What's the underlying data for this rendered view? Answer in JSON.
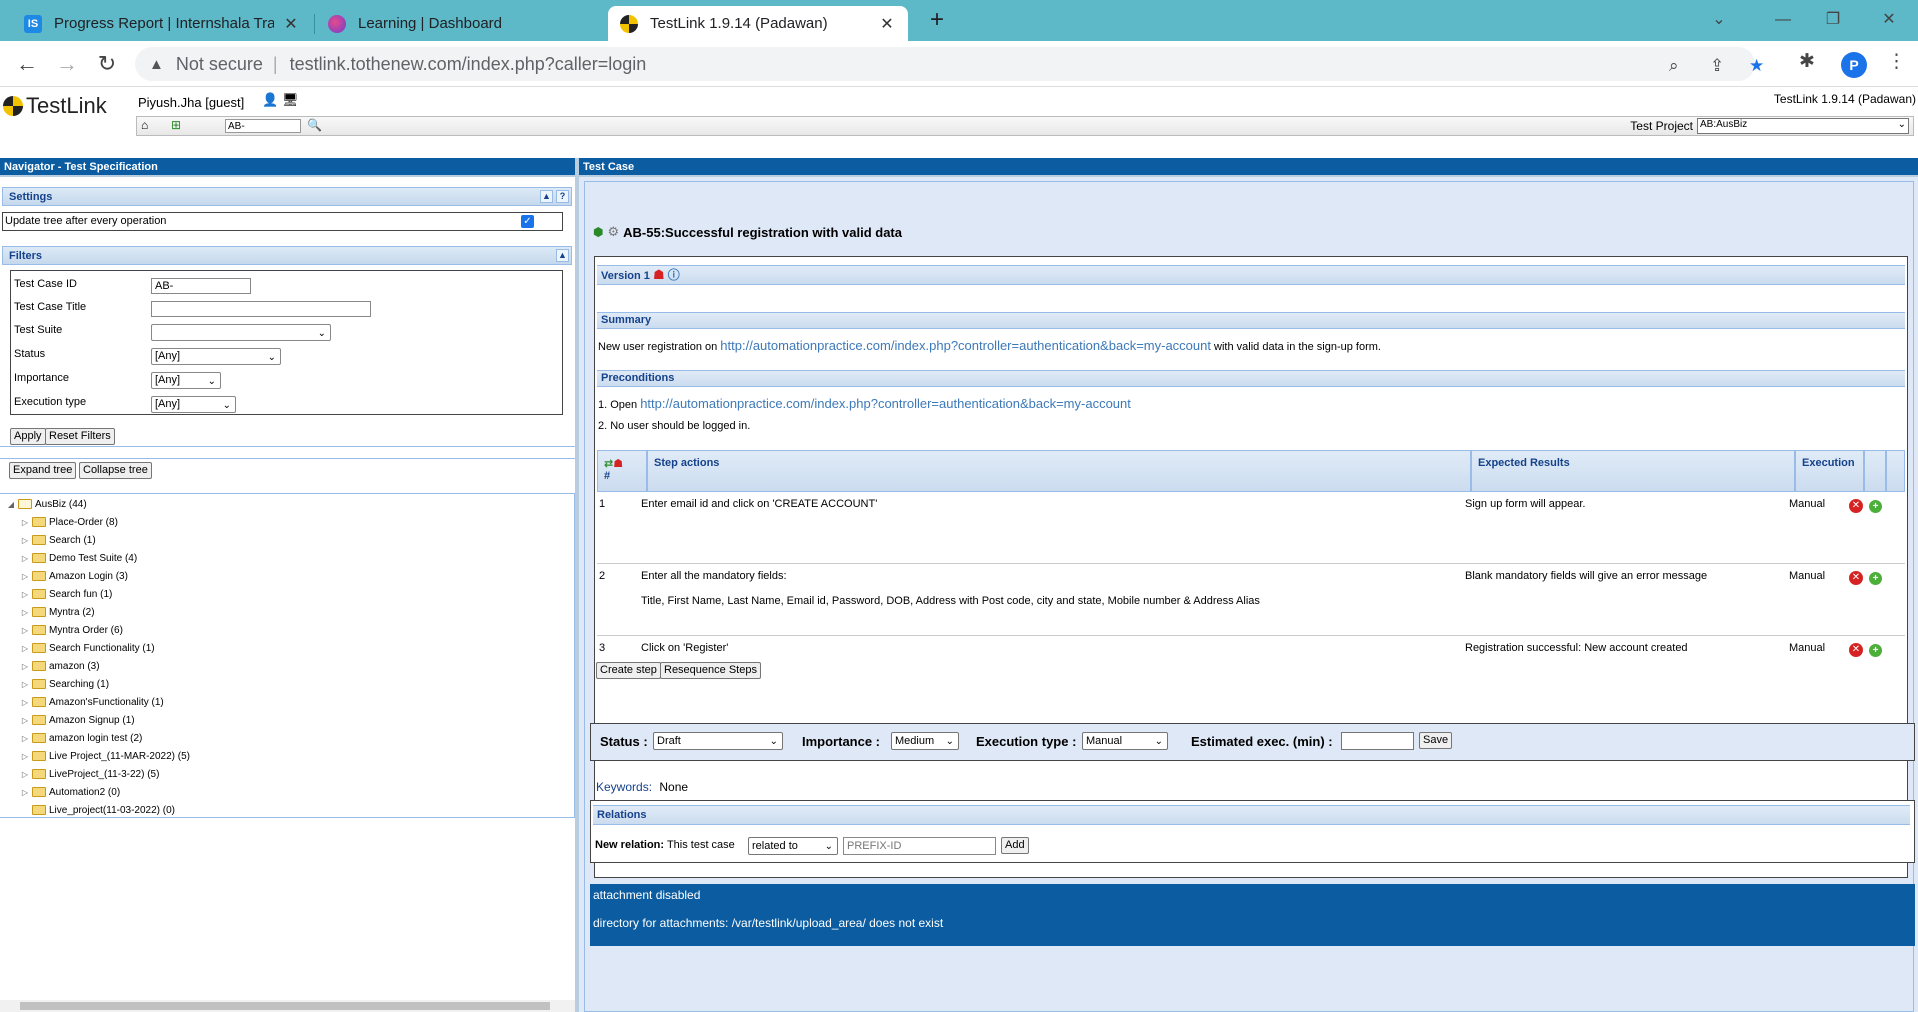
{
  "browser": {
    "tabs": [
      {
        "title": "Progress Report | Internshala Trai",
        "favicon": "IS"
      },
      {
        "title": "Learning | Dashboard",
        "favicon": ""
      },
      {
        "title": "TestLink 1.9.14 (Padawan)",
        "favicon": ""
      }
    ],
    "not_secure": "Not secure",
    "url": "testlink.tothenew.com/index.php?caller=login",
    "profile_initial": "P"
  },
  "header": {
    "logo_text": "TestLink",
    "user": "Piyush.Jha [guest]",
    "version": "TestLink 1.9.14 (Padawan)",
    "quick_tc_value": "AB-",
    "test_project_label": "Test Project",
    "test_project_value": "AB:AusBiz"
  },
  "navigator": {
    "title": "Navigator - Test Specification",
    "settings_title": "Settings",
    "update_tree_label": "Update tree after every operation",
    "filters_title": "Filters",
    "filters": [
      {
        "label": "Test Case ID",
        "value": "AB-"
      },
      {
        "label": "Test Case Title",
        "value": ""
      },
      {
        "label": "Test Suite",
        "value": ""
      },
      {
        "label": "Status",
        "value": "[Any]"
      },
      {
        "label": "Importance",
        "value": "[Any]"
      },
      {
        "label": "Execution type",
        "value": "[Any]"
      }
    ],
    "apply_label": "Apply",
    "reset_label": "Reset Filters",
    "expand_label": "Expand tree",
    "collapse_label": "Collapse tree",
    "tree_root": "AusBiz (44)",
    "tree": [
      "Place-Order (8)",
      "Search (1)",
      "Demo Test Suite (4)",
      "Amazon Login (3)",
      "Search fun (1)",
      "Myntra (2)",
      "Myntra Order (6)",
      "Search Functionality (1)",
      "amazon (3)",
      "Searching (1)",
      "Amazon'sFunctionality (1)",
      "Amazon Signup (1)",
      "amazon login test (2)",
      "Live Project_(11-MAR-2022) (5)",
      "LiveProject_(11-3-22) (5)",
      "Automation2 (0)",
      "Live_project(11-03-2022) (0)"
    ]
  },
  "testcase": {
    "pane_title": "Test Case",
    "title": "AB-55:Successful registration with valid data",
    "version": "Version 1",
    "summary_title": "Summary",
    "summary_pre": "New user registration on",
    "summary_link": "http://automationpractice.com/index.php?controller=authentication&back=my-account",
    "summary_post": "with valid data in the sign-up form.",
    "preconditions_title": "Preconditions",
    "pre1_prefix": "1. Open",
    "pre1_link": "http://automationpractice.com/index.php?controller=authentication&back=my-account",
    "pre2": "2. No user should be logged in.",
    "steps_headers": {
      "num": "#",
      "actions": "Step actions",
      "expected": "Expected Results",
      "execution": "Execution"
    },
    "steps": [
      {
        "num": "1",
        "action": "Enter email id and click on 'CREATE ACCOUNT'",
        "action2": "",
        "expected": "Sign up form will appear.",
        "execution": "Manual"
      },
      {
        "num": "2",
        "action": "Enter all the mandatory fields:",
        "action2": "Title, First Name, Last Name, Email id, Password,  DOB,  Address with Post code, city and state, Mobile number & Address Alias",
        "expected": "Blank mandatory fields will give an error message",
        "execution": "Manual"
      },
      {
        "num": "3",
        "action": "Click on 'Register'",
        "action2": "",
        "expected": "Registration successful: New account created",
        "execution": "Manual"
      }
    ],
    "create_step": "Create step",
    "resequence": "Resequence Steps",
    "status_label": "Status :",
    "status_value": "Draft",
    "importance_label": "Importance :",
    "importance_value": "Medium",
    "exec_type_label": "Execution type :",
    "exec_type_value": "Manual",
    "est_label": "Estimated exec. (min) :",
    "est_value": "",
    "save_label": "Save",
    "keywords_label": "Keywords:",
    "keywords_value": "None",
    "relations_title": "Relations",
    "new_relation_label": "New relation:",
    "this_test_case": "This test case",
    "relation_type": "related to",
    "relation_placeholder": "PREFIX-ID",
    "add_label": "Add",
    "attach_line1": "attachment disabled",
    "attach_line2": "directory for attachments: /var/testlink/upload_area/ does not exist"
  }
}
